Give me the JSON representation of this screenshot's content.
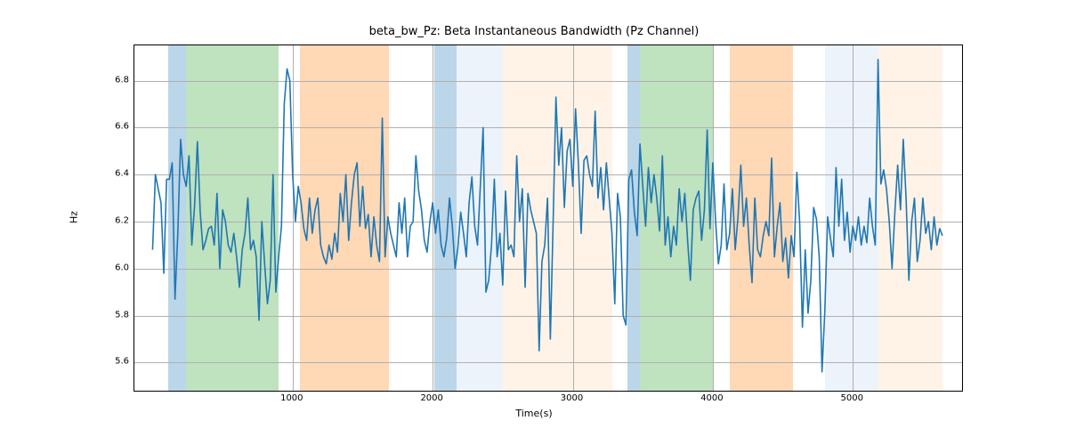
{
  "chart_data": {
    "type": "line",
    "title": "beta_bw_Pz: Beta Instantaneous Bandwidth (Pz Channel)",
    "xlabel": "Time(s)",
    "ylabel": "Hz",
    "xlim": [
      -130,
      5780
    ],
    "ylim": [
      5.48,
      6.95
    ],
    "xticks": [
      1000,
      2000,
      3000,
      4000,
      5000
    ],
    "yticks": [
      5.6,
      5.8,
      6.0,
      6.2,
      6.4,
      6.6,
      6.8
    ],
    "bands": [
      {
        "x0": 110,
        "x1": 240,
        "color": "#1f77b4"
      },
      {
        "x0": 240,
        "x1": 900,
        "color": "#2ca02c"
      },
      {
        "x0": 1050,
        "x1": 1690,
        "color": "#ff7f0e"
      },
      {
        "x0": 2010,
        "x1": 2170,
        "color": "#1f77b4"
      },
      {
        "x0": 2170,
        "x1": 2500,
        "color": "#bfd8ef"
      },
      {
        "x0": 2500,
        "x1": 3280,
        "color": "#ffd8b0"
      },
      {
        "x0": 3390,
        "x1": 3480,
        "color": "#1f77b4"
      },
      {
        "x0": 3480,
        "x1": 4000,
        "color": "#2ca02c"
      },
      {
        "x0": 4120,
        "x1": 4570,
        "color": "#ff7f0e"
      },
      {
        "x0": 4800,
        "x1": 4900,
        "color": "#bfd8ef"
      },
      {
        "x0": 4900,
        "x1": 5180,
        "color": "#bfd8ef"
      },
      {
        "x0": 5180,
        "x1": 5640,
        "color": "#ffd8b0"
      }
    ],
    "x": [
      0,
      20,
      40,
      60,
      80,
      100,
      120,
      140,
      160,
      180,
      200,
      220,
      240,
      260,
      280,
      300,
      320,
      340,
      360,
      380,
      400,
      420,
      440,
      460,
      480,
      500,
      520,
      540,
      560,
      580,
      600,
      620,
      640,
      660,
      680,
      700,
      720,
      740,
      760,
      780,
      800,
      820,
      840,
      860,
      880,
      900,
      920,
      940,
      960,
      980,
      1000,
      1020,
      1040,
      1060,
      1080,
      1100,
      1120,
      1140,
      1160,
      1180,
      1200,
      1220,
      1240,
      1260,
      1280,
      1300,
      1320,
      1340,
      1360,
      1380,
      1400,
      1420,
      1440,
      1460,
      1480,
      1500,
      1520,
      1540,
      1560,
      1580,
      1600,
      1620,
      1640,
      1660,
      1680,
      1700,
      1720,
      1740,
      1760,
      1780,
      1800,
      1820,
      1840,
      1860,
      1880,
      1900,
      1920,
      1940,
      1960,
      1980,
      2000,
      2020,
      2040,
      2060,
      2080,
      2100,
      2120,
      2140,
      2160,
      2180,
      2200,
      2220,
      2240,
      2260,
      2280,
      2300,
      2320,
      2340,
      2360,
      2380,
      2400,
      2420,
      2440,
      2460,
      2480,
      2500,
      2520,
      2540,
      2560,
      2580,
      2600,
      2620,
      2640,
      2660,
      2680,
      2700,
      2720,
      2740,
      2760,
      2780,
      2800,
      2820,
      2840,
      2860,
      2880,
      2900,
      2920,
      2940,
      2960,
      2980,
      3000,
      3020,
      3040,
      3060,
      3080,
      3100,
      3120,
      3140,
      3160,
      3180,
      3200,
      3220,
      3240,
      3260,
      3280,
      3300,
      3320,
      3340,
      3360,
      3380,
      3400,
      3420,
      3440,
      3460,
      3480,
      3500,
      3520,
      3540,
      3560,
      3580,
      3600,
      3620,
      3640,
      3660,
      3680,
      3700,
      3720,
      3740,
      3760,
      3780,
      3800,
      3820,
      3840,
      3860,
      3880,
      3900,
      3920,
      3940,
      3960,
      3980,
      4000,
      4020,
      4040,
      4060,
      4080,
      4100,
      4120,
      4140,
      4160,
      4180,
      4200,
      4220,
      4240,
      4260,
      4280,
      4300,
      4320,
      4340,
      4360,
      4380,
      4400,
      4420,
      4440,
      4460,
      4480,
      4500,
      4520,
      4540,
      4560,
      4580,
      4600,
      4620,
      4640,
      4660,
      4680,
      4700,
      4720,
      4740,
      4760,
      4780,
      4800,
      4820,
      4840,
      4860,
      4880,
      4900,
      4920,
      4940,
      4960,
      4980,
      5000,
      5020,
      5040,
      5060,
      5080,
      5100,
      5120,
      5140,
      5160,
      5180,
      5200,
      5220,
      5240,
      5260,
      5280,
      5300,
      5320,
      5340,
      5360,
      5380,
      5400,
      5420,
      5440,
      5460,
      5480,
      5500,
      5520,
      5540,
      5560,
      5580,
      5600,
      5620,
      5640
    ],
    "values": [
      6.08,
      6.4,
      6.34,
      6.28,
      5.98,
      6.38,
      6.38,
      6.45,
      5.87,
      6.15,
      6.55,
      6.4,
      6.35,
      6.48,
      6.1,
      6.27,
      6.54,
      6.24,
      6.08,
      6.12,
      6.17,
      6.18,
      6.1,
      6.32,
      6.0,
      6.25,
      6.2,
      6.1,
      6.07,
      6.15,
      6.05,
      5.92,
      6.08,
      6.15,
      6.3,
      6.08,
      6.12,
      6.05,
      5.78,
      6.2,
      6.02,
      5.85,
      5.95,
      6.4,
      5.9,
      6.05,
      6.18,
      6.7,
      6.85,
      6.8,
      6.4,
      6.2,
      6.35,
      6.28,
      6.17,
      6.12,
      6.3,
      6.15,
      6.25,
      6.3,
      6.1,
      6.05,
      6.02,
      6.1,
      6.04,
      6.15,
      6.07,
      6.32,
      6.2,
      6.4,
      6.12,
      6.28,
      6.4,
      6.45,
      6.18,
      6.35,
      6.17,
      6.23,
      6.05,
      6.22,
      6.1,
      6.03,
      6.64,
      6.05,
      6.22,
      6.15,
      6.1,
      6.05,
      6.28,
      6.15,
      6.3,
      6.05,
      6.18,
      6.2,
      6.48,
      6.33,
      6.25,
      6.12,
      6.07,
      6.2,
      6.28,
      6.15,
      6.25,
      6.1,
      6.05,
      6.13,
      6.3,
      6.18,
      6.0,
      6.09,
      6.24,
      6.15,
      6.05,
      6.28,
      6.39,
      6.18,
      6.1,
      6.35,
      6.6,
      5.9,
      5.95,
      6.1,
      6.38,
      6.05,
      6.15,
      5.93,
      6.33,
      6.08,
      6.1,
      6.05,
      6.48,
      6.2,
      6.34,
      5.92,
      6.32,
      6.25,
      6.2,
      6.15,
      5.65,
      6.03,
      6.1,
      6.3,
      5.7,
      6.2,
      6.73,
      6.44,
      6.6,
      6.26,
      6.5,
      6.55,
      6.35,
      6.68,
      6.45,
      6.15,
      6.46,
      6.48,
      6.4,
      6.35,
      6.67,
      6.3,
      6.43,
      6.25,
      6.45,
      6.3,
      6.15,
      5.85,
      6.32,
      6.22,
      5.8,
      5.76,
      6.38,
      6.42,
      6.24,
      6.14,
      6.53,
      6.35,
      6.18,
      6.43,
      6.28,
      6.4,
      6.3,
      6.16,
      6.48,
      6.1,
      6.22,
      6.05,
      6.18,
      6.1,
      6.34,
      6.2,
      6.32,
      6.12,
      5.95,
      6.25,
      6.3,
      6.33,
      6.12,
      6.25,
      6.59,
      6.17,
      6.45,
      6.2,
      6.02,
      6.1,
      6.36,
      6.08,
      6.15,
      6.34,
      6.08,
      6.22,
      6.44,
      6.18,
      6.3,
      6.1,
      5.94,
      6.3,
      6.08,
      6.05,
      6.14,
      6.2,
      6.14,
      6.47,
      6.05,
      6.18,
      6.28,
      6.03,
      6.13,
      5.96,
      6.14,
      6.05,
      6.41,
      6.2,
      5.75,
      6.08,
      5.81,
      5.95,
      6.26,
      6.21,
      6.05,
      5.56,
      5.82,
      6.22,
      6.13,
      6.05,
      6.43,
      6.18,
      6.38,
      6.12,
      6.24,
      6.07,
      6.18,
      6.12,
      6.22,
      6.1,
      6.18,
      6.11,
      6.3,
      6.18,
      6.1,
      6.89,
      6.36,
      6.42,
      6.34,
      6.2,
      6.0,
      6.24,
      6.44,
      6.25,
      6.55,
      6.3,
      5.95,
      6.2,
      6.3,
      6.03,
      6.12,
      6.3,
      6.15,
      6.2,
      6.08,
      6.22,
      6.1,
      6.17,
      6.14
    ]
  }
}
